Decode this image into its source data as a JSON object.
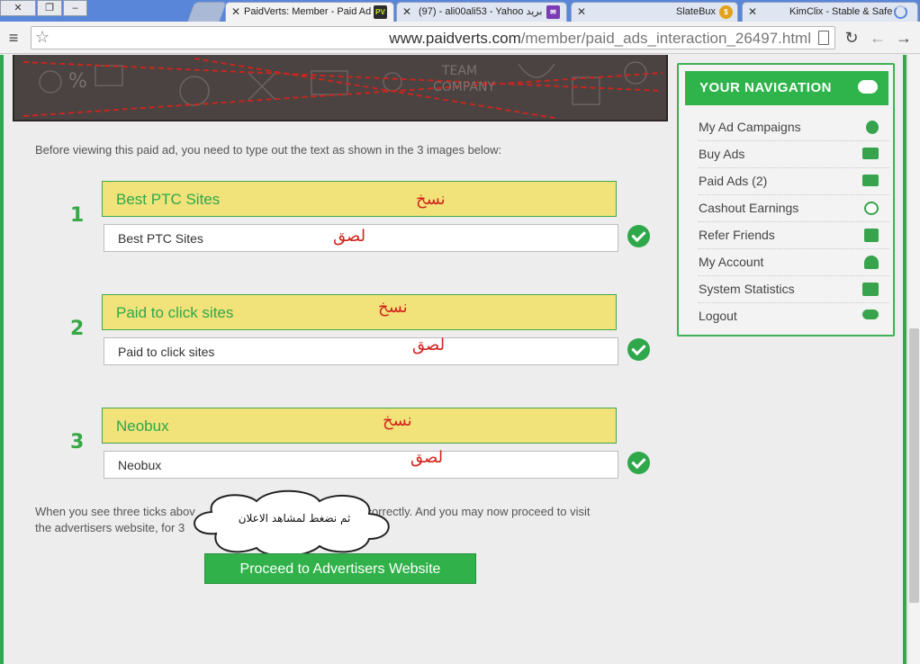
{
  "browser": {
    "tabs": [
      {
        "title": "PaidVerts: Member - Paid Ad",
        "favicon": "PV"
      },
      {
        "title": "(97) - ali00ali53 - Yahoo بريد"
      },
      {
        "title": "SlateBux"
      },
      {
        "title": "KimClix - Stable & Safe"
      }
    ],
    "url_host": "www.paidverts.com",
    "url_path": "/member/paid_ads_interaction_26497.html"
  },
  "page": {
    "intro": "Before viewing this paid ad, you need to type out the text as shown in the 3 images below:",
    "steps": [
      {
        "num": "1",
        "captcha": "Best PTC Sites",
        "answer": "Best PTC Sites",
        "copy_label": "نسخ",
        "paste_label": "لصق"
      },
      {
        "num": "2",
        "captcha": "Paid to click sites",
        "answer": "Paid to click sites",
        "copy_label": "نسخ",
        "paste_label": "لصق"
      },
      {
        "num": "3",
        "captcha": "Neobux",
        "answer": "Neobux",
        "copy_label": "نسخ",
        "paste_label": "لصق"
      }
    ],
    "note_left_1": "When you see three ticks abov",
    "note_right_1": "xt correctly. And you may now proceed to visit",
    "note_line_2": "the advertisers website, for 3",
    "callout": "ثم نضغط لمشاهد الاعلان",
    "proceed_label": "Proceed to Advertisers Website"
  },
  "navigation": {
    "title": "YOUR NAVIGATION",
    "items": [
      {
        "label": "My Ad Campaigns",
        "icon": "share-icon"
      },
      {
        "label": "Buy Ads",
        "icon": "money-icon"
      },
      {
        "label": "Paid Ads (2)",
        "icon": "folder-open-icon"
      },
      {
        "label": "Cashout Earnings",
        "icon": "money-bag-icon"
      },
      {
        "label": "Refer Friends",
        "icon": "sitemap-icon"
      },
      {
        "label": "My Account",
        "icon": "user-icon"
      },
      {
        "label": "System Statistics",
        "icon": "presentation-icon"
      },
      {
        "label": "Logout",
        "icon": "cloud-upload-icon"
      }
    ]
  },
  "colors": {
    "accent_green": "#2fb34b",
    "captcha_yellow": "#f1e27a",
    "annotation_red": "#d2231c"
  }
}
